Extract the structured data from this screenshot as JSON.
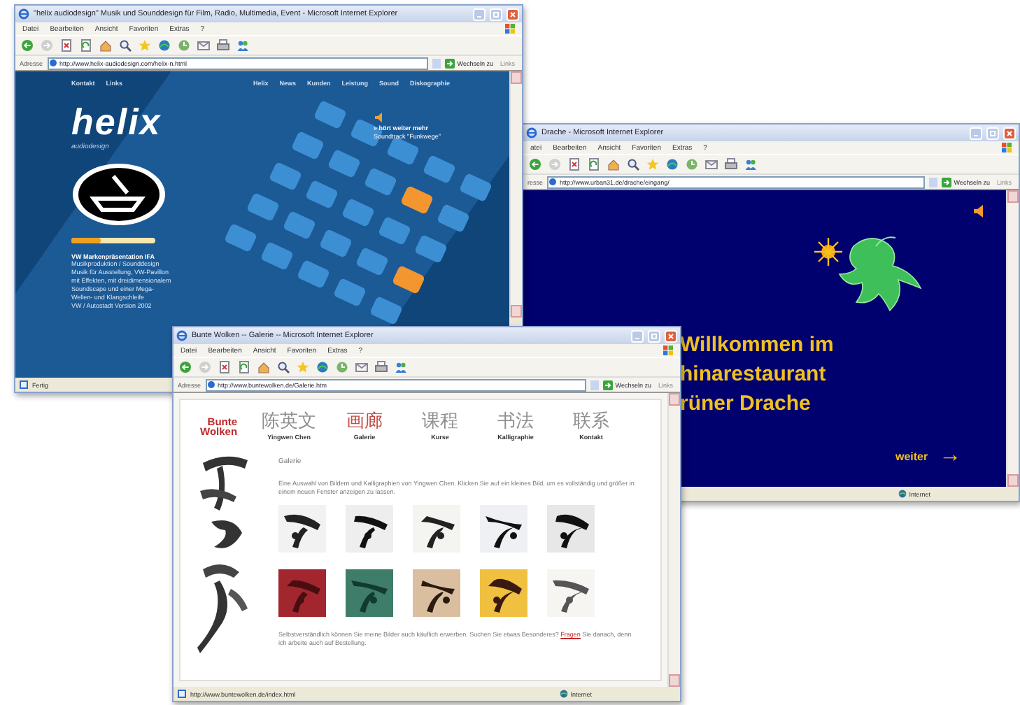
{
  "windows": [
    {
      "kind": "helix",
      "title": "\"helix audiodesign\" Musik und Sounddesign für Film, Radio, Multimedia, Event - Microsoft Internet Explorer",
      "menu": [
        "Datei",
        "Bearbeiten",
        "Ansicht",
        "Favoriten",
        "Extras",
        "?"
      ],
      "address_label": "Adresse",
      "url": "http://www.helix-audiodesign.com/helix-n.html",
      "go": "Wechseln zu",
      "links": "Links",
      "status": "Fertig",
      "page": {
        "nav_left": [
          "Kontakt",
          "Links"
        ],
        "nav_right": [
          "Helix",
          "News",
          "Kunden",
          "Leistung",
          "Sound",
          "Diskographie"
        ],
        "logo": "helix",
        "tagline": "audiodesign",
        "volume": {
          "level": 0.35
        },
        "project_title": "VW Markenpräsentation IFA",
        "project_lines": [
          "Musikproduktion / Sounddesign",
          "Musik für Ausstellung, VW-Pavillon",
          "mit Effekten, mit dreidimensionalem",
          "Soundscape und einer Mega-",
          "Wellen- und Klangschleife",
          "VW / Autostadt Version 2002"
        ],
        "teaser": [
          "» hört weiter mehr",
          "Soundtrack \"Funkwege\""
        ]
      }
    },
    {
      "kind": "drache",
      "title": "Drache - Microsoft Internet Explorer",
      "menu": [
        "atei",
        "Bearbeiten",
        "Ansicht",
        "Favoriten",
        "Extras",
        "?"
      ],
      "address_label": "resse",
      "url": "http://www.urban31.de/drache/eingang/",
      "go": "Wechseln zu",
      "links": "Links",
      "zone": "Internet",
      "page": {
        "heading": [
          "Willkommen im",
          "hinarestaurant",
          "rüner Drache"
        ],
        "next": "weiter",
        "next_arrow": "→"
      }
    },
    {
      "kind": "galerie",
      "title": "Bunte Wolken -- Galerie -- Microsoft Internet Explorer",
      "menu": [
        "Datei",
        "Bearbeiten",
        "Ansicht",
        "Favoriten",
        "Extras",
        "?"
      ],
      "address_label": "Adresse",
      "url": "http://www.buntewolken.de/Galerie.htm",
      "go": "Wechseln zu",
      "links": "Links",
      "status": "http://www.buntewolken.de/index.html",
      "zone": "Internet",
      "page": {
        "logo": [
          "Bunte",
          "Wolken"
        ],
        "nav": [
          {
            "chinese": "陈英文",
            "label": "Yingwen Chen",
            "selected": false
          },
          {
            "chinese": "画廊",
            "label": "Galerie",
            "selected": true
          },
          {
            "chinese": "课程",
            "label": "Kurse",
            "selected": false
          },
          {
            "chinese": "书法",
            "label": "Kalligraphie",
            "selected": false
          },
          {
            "chinese": "联系",
            "label": "Kontakt",
            "selected": false
          }
        ],
        "heading": "Galerie",
        "intro": "Eine Auswahl von Bildern und Kalligraphien von Yingwen Chen. Klicken Sie auf ein kleines Bild, um es vollständig und größer in einem neuen Fenster anzeigen zu lassen.",
        "thumbnails": [
          {
            "kind": "picture"
          },
          {
            "kind": "picture"
          },
          {
            "kind": "picture"
          },
          {
            "kind": "picture"
          },
          {
            "kind": "picture"
          },
          {
            "kind": "picture"
          },
          {
            "kind": "picture"
          },
          {
            "kind": "picture"
          },
          {
            "kind": "picture"
          },
          {
            "kind": "picture"
          }
        ],
        "footer": {
          "before": "Selbstverständlich können Sie meine Bilder auch käuflich erwerben. Suchen Sie etwas Besonderes? ",
          "link": "Fragen",
          "after": " Sie danach, denn ich arbeite auch auf Bestellung."
        }
      }
    }
  ]
}
